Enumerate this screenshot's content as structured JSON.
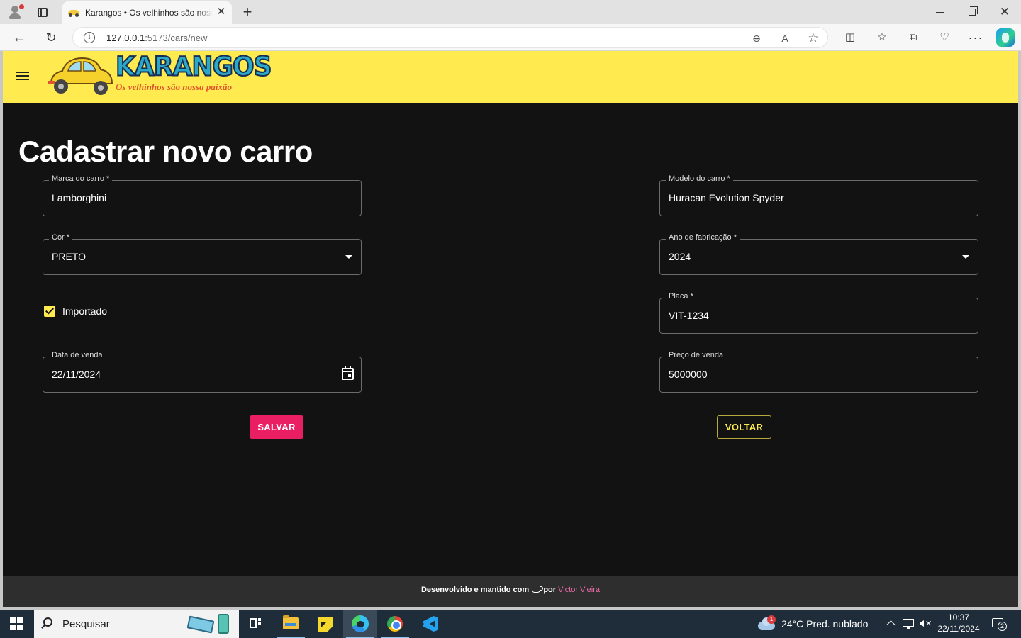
{
  "browser": {
    "tab_title": "Karangos • Os velhinhos são nossa paixão",
    "url_host": "127.0.0.1",
    "url_path": ":5173/cars/new",
    "accent": "#1a9ef0"
  },
  "appbar": {
    "brand": "KARANGOS",
    "slogan": "Os velhinhos são nossa paixão",
    "color": "#ffeb4f"
  },
  "page": {
    "title": "Cadastrar novo carro"
  },
  "form": {
    "brand": {
      "label": "Marca do carro *",
      "value": "Lamborghini"
    },
    "model": {
      "label": "Modelo do carro *",
      "value": "Huracan Evolution Spyder"
    },
    "color": {
      "label": "Cor *",
      "value": "PRETO"
    },
    "year": {
      "label": "Ano de fabricação *",
      "value": "2024"
    },
    "imported": {
      "label": "Importado",
      "checked": true
    },
    "plate": {
      "label": "Placa *",
      "value": "VIT-1234"
    },
    "sale_date": {
      "label": "Data de venda",
      "value": "22/11/2024"
    },
    "price": {
      "label": "Preço de venda",
      "value": "5000000"
    }
  },
  "buttons": {
    "save": "SALVAR",
    "back": "VOLTAR",
    "save_color": "#e91e63",
    "back_color": "#ffeb4f"
  },
  "footer": {
    "text_before": "Desenvolvido e mantido com",
    "text_after": "por",
    "author": "Victor Vieira",
    "icon": "coffee-icon"
  },
  "taskbar": {
    "search_placeholder": "Pesquisar",
    "weather_badge": "1",
    "weather": "24°C  Pred. nublado",
    "time": "10:37",
    "date": "22/11/2024",
    "notification_count": "2"
  }
}
